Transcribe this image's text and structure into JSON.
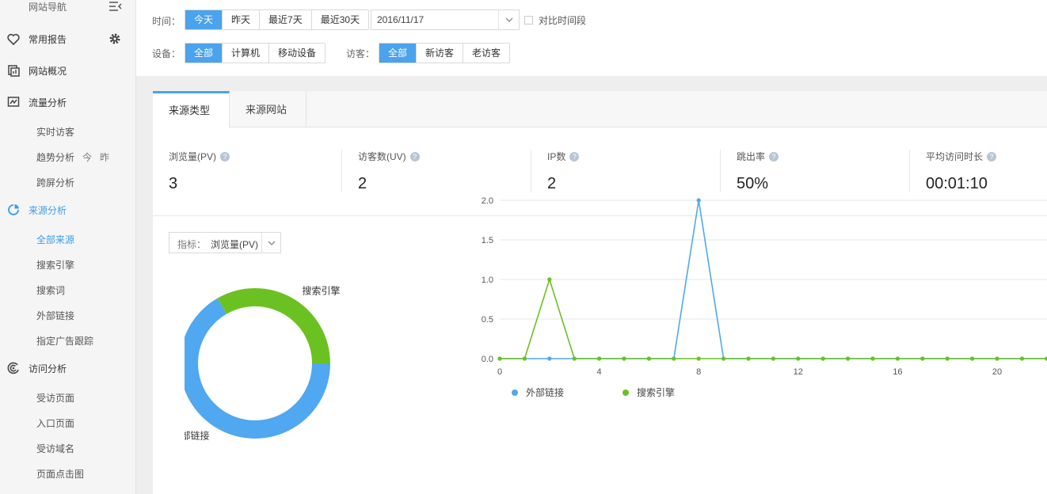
{
  "sidebar": {
    "nav_title": "网站导航",
    "sections": [
      {
        "label": "常用报告"
      },
      {
        "label": "网站概况"
      },
      {
        "label": "流量分析"
      },
      {
        "label": "来源分析"
      },
      {
        "label": "访问分析"
      }
    ],
    "traffic_items": [
      "实时访客",
      "趋势分析",
      "跨屏分析"
    ],
    "trend_today": "今",
    "trend_yesterday": "昨",
    "source_items": [
      "全部来源",
      "搜索引擎",
      "搜索词",
      "外部链接",
      "指定广告跟踪"
    ],
    "visit_items": [
      "受访页面",
      "入口页面",
      "受访域名",
      "页面点击图"
    ]
  },
  "filters": {
    "time_label": "时间：",
    "time_options": [
      "今天",
      "昨天",
      "最近7天",
      "最近30天"
    ],
    "date_value": "2016/11/17",
    "compare_label": "对比时间段",
    "device_label": "设备：",
    "device_options": [
      "全部",
      "计算机",
      "移动设备"
    ],
    "visitor_label": "访客：",
    "visitor_options": [
      "全部",
      "新访客",
      "老访客"
    ]
  },
  "tabs": [
    "来源类型",
    "来源网站"
  ],
  "metrics": [
    {
      "label": "浏览量(PV)",
      "value": "3"
    },
    {
      "label": "访客数(UV)",
      "value": "2"
    },
    {
      "label": "IP数",
      "value": "2"
    },
    {
      "label": "跳出率",
      "value": "50%"
    },
    {
      "label": "平均访问时长",
      "value": "00:01:10"
    }
  ],
  "indicator": {
    "key": "指标：",
    "value": "浏览量(PV)"
  },
  "colors": {
    "accent": "#4aa3ec",
    "blue_series": "#4fa8f0",
    "green_series": "#6cc122"
  },
  "chart_data": [
    {
      "type": "pie",
      "labels": [
        "外部链接",
        "搜索引擎"
      ],
      "values": [
        2,
        1
      ]
    },
    {
      "type": "line",
      "x": [
        0,
        1,
        2,
        3,
        4,
        5,
        6,
        7,
        8,
        9,
        10,
        11,
        12,
        13,
        14,
        15,
        16,
        17,
        18,
        19,
        20,
        21,
        22,
        23
      ],
      "series": [
        {
          "name": "外部链接",
          "values": [
            0,
            0,
            0,
            0,
            0,
            0,
            0,
            0,
            2,
            0,
            0,
            0,
            0,
            0,
            0,
            0,
            0,
            0,
            0,
            0,
            0,
            0,
            0,
            0
          ]
        },
        {
          "name": "搜索引擎",
          "values": [
            0,
            0,
            1,
            0,
            0,
            0,
            0,
            0,
            0,
            0,
            0,
            0,
            0,
            0,
            0,
            0,
            0,
            0,
            0,
            0,
            0,
            0,
            0,
            0
          ]
        }
      ],
      "ylim": [
        0,
        2
      ],
      "yticks": [
        "0.0",
        "0.5",
        "1.0",
        "1.5",
        "2.0"
      ],
      "xticks": [
        "0",
        "4",
        "8",
        "12",
        "16",
        "20"
      ],
      "grid": true,
      "legend": "bottom-left"
    }
  ]
}
